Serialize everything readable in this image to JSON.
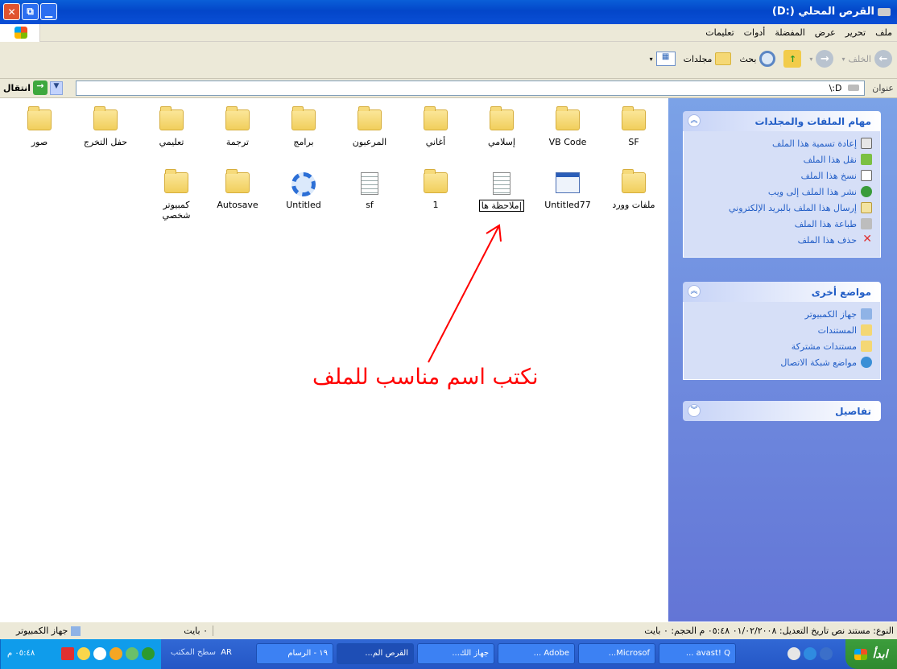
{
  "window": {
    "title": "القرص المحلي (:D)"
  },
  "menu": [
    "ملف",
    "تحرير",
    "عرض",
    "المفضلة",
    "أدوات",
    "تعليمات"
  ],
  "toolbar": {
    "back": "الخلف",
    "search": "بحث",
    "folders": "مجلدات"
  },
  "address": {
    "label": "عنوان",
    "value": "D:\\",
    "go": "انتقال"
  },
  "files": [
    {
      "name": "SF",
      "type": "folder"
    },
    {
      "name": "VB Code",
      "type": "folder"
    },
    {
      "name": "إسلامي",
      "type": "folder"
    },
    {
      "name": "أغاني",
      "type": "folder"
    },
    {
      "name": "المرعبون",
      "type": "folder"
    },
    {
      "name": "برامج",
      "type": "folder"
    },
    {
      "name": "ترجمة",
      "type": "folder"
    },
    {
      "name": "تعليمي",
      "type": "folder"
    },
    {
      "name": "حفل التخرج",
      "type": "folder"
    },
    {
      "name": "صور",
      "type": "folder"
    },
    {
      "name": "ملفات وورد",
      "type": "folder"
    },
    {
      "name": "Untitled77",
      "type": "vb"
    },
    {
      "name": "ملاحظة ها|",
      "type": "doc"
    },
    {
      "name": "1",
      "type": "folder"
    },
    {
      "name": "sf",
      "type": "doc"
    },
    {
      "name": "Untitled",
      "type": "gear"
    },
    {
      "name": "Autosave",
      "type": "folder"
    },
    {
      "name": "كمبيوتر شخصي",
      "type": "folder"
    }
  ],
  "tasks": {
    "title": "مهام الملفات والمجلدات",
    "items": [
      "إعادة تسمية هذا الملف",
      "نقل هذا الملف",
      "نسخ هذا الملف",
      "نشر هذا الملف إلى ويب",
      "إرسال هذا الملف بالبريد الإلكتروني",
      "طباعة هذا الملف",
      "حذف هذا الملف"
    ]
  },
  "places": {
    "title": "مواضع أخرى",
    "items": [
      "جهاز الكمبيوتر",
      "المستندات",
      "مستندات مشتركة",
      "مواضع شبكة الاتصال"
    ]
  },
  "details": {
    "title": "تفاصيل"
  },
  "annotation": "نكتب اسم مناسب للملف",
  "status": {
    "info": "النوع: مستند نص تاريخ التعديل: ٠١/٠٢/٢٠٠٨ ٠٥:٤٨ م الحجم: ٠ بايت",
    "size": "٠ بايت",
    "location": "جهاز الكمبيوتر"
  },
  "taskbar": {
    "start": "ابدأ",
    "buttons": [
      "القرص الم...",
      "جهاز الك...",
      "Adobe ...",
      "Microsof...",
      "avast! Q ...",
      "١٩ - الرسام"
    ],
    "desktop": "سطح المكتب",
    "lang": "AR",
    "clock": "٠٥:٤٨ م"
  },
  "colors": {
    "titlebar": "#0346c9",
    "panel": "#6375d6",
    "annotation": "#ff0000"
  }
}
